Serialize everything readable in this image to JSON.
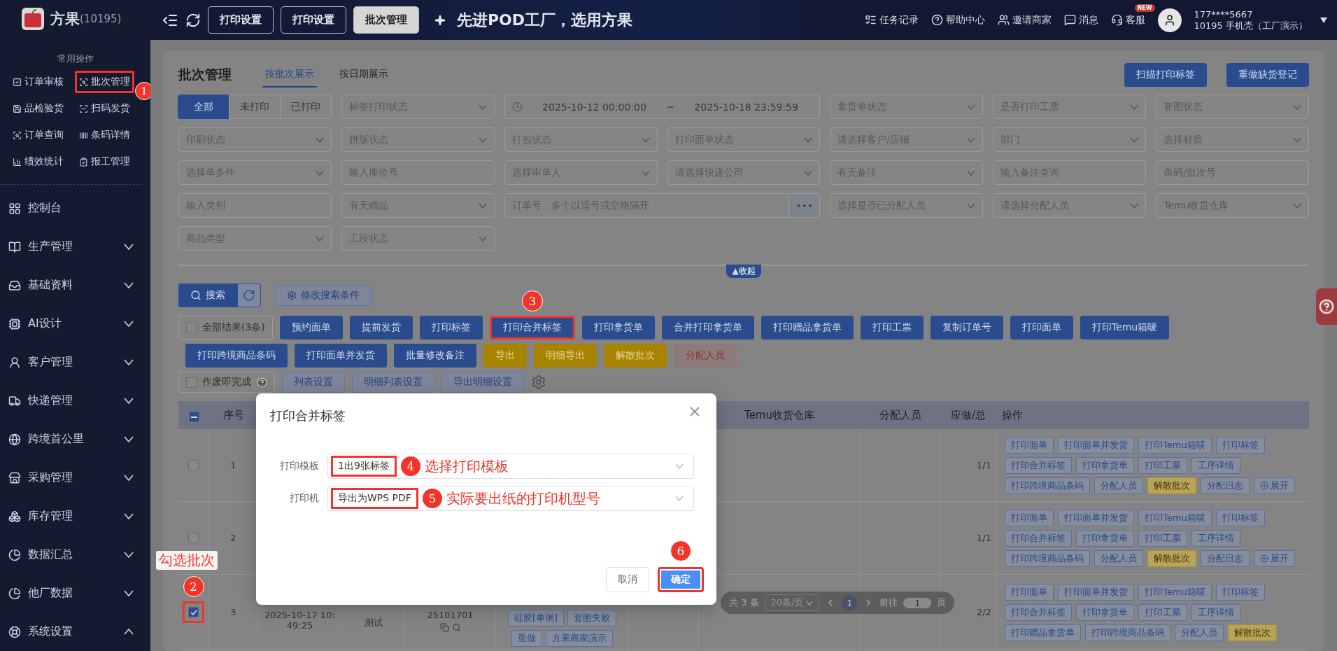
{
  "sidebar": {
    "brand": "方果",
    "brand_id": "(10195)",
    "quick_title": "常用操作",
    "quick_items": [
      {
        "label": "订单审核",
        "annotated": false
      },
      {
        "label": "批次管理",
        "annotated": true,
        "badge": "1"
      },
      {
        "label": "品检验货",
        "annotated": false
      },
      {
        "label": "扫码发货",
        "annotated": false
      },
      {
        "label": "订单查询",
        "annotated": false
      },
      {
        "label": "条码详情",
        "annotated": false
      },
      {
        "label": "绩效统计",
        "annotated": false
      },
      {
        "label": "报工管理",
        "annotated": false
      }
    ],
    "menu": [
      {
        "label": "控制台",
        "kind": "link"
      },
      {
        "label": "生产管理",
        "kind": "group",
        "expanded": false
      },
      {
        "label": "基础资料",
        "kind": "group",
        "expanded": false
      },
      {
        "label": "AI设计",
        "kind": "group",
        "expanded": false
      },
      {
        "label": "客户管理",
        "kind": "group",
        "expanded": false
      },
      {
        "label": "快递管理",
        "kind": "group",
        "expanded": false
      },
      {
        "label": "跨境首公里",
        "kind": "group",
        "expanded": false
      },
      {
        "label": "采购管理",
        "kind": "group",
        "expanded": false
      },
      {
        "label": "库存管理",
        "kind": "group",
        "expanded": false
      },
      {
        "label": "数据汇总",
        "kind": "group",
        "expanded": false
      },
      {
        "label": "他厂数据",
        "kind": "group",
        "expanded": false
      },
      {
        "label": "系统设置",
        "kind": "group",
        "expanded": true
      }
    ]
  },
  "header": {
    "tabs": [
      {
        "label": "打印设置",
        "selected": false
      },
      {
        "label": "打印设置",
        "selected": false
      },
      {
        "label": "批次管理",
        "selected": true
      }
    ],
    "slogan": "先进POD工厂，选用方果",
    "links": [
      {
        "label": "任务记录"
      },
      {
        "label": "帮助中心"
      },
      {
        "label": "邀请商家"
      },
      {
        "label": "消息"
      },
      {
        "label": "客服",
        "badge": "NEW"
      }
    ],
    "user": {
      "phone": "177****5667",
      "account": "10195  手机壳（工厂演示）"
    }
  },
  "page": {
    "title": "批次管理",
    "view_tabs": [
      {
        "label": "按批次展示",
        "selected": true
      },
      {
        "label": "按日期展示",
        "selected": false
      }
    ],
    "top_buttons": [
      "扫描打印标签",
      "重做缺货登记"
    ]
  },
  "filters": [
    [
      {
        "kind": "segment",
        "options": [
          {
            "label": "全部",
            "selected": true
          },
          {
            "label": "未打印",
            "selected": false
          },
          {
            "label": "已打印",
            "selected": false
          }
        ]
      },
      {
        "kind": "select",
        "placeholder": "标签打印状态"
      },
      {
        "kind": "date_range",
        "start": "2025-10-12 00:00:00",
        "separator": "~",
        "end": "2025-10-18 23:59:59"
      },
      {
        "kind": "select",
        "placeholder": "拿货单状态"
      },
      {
        "kind": "select",
        "placeholder": "是否打印工票"
      },
      {
        "kind": "select",
        "placeholder": "套图状态"
      }
    ],
    [
      {
        "kind": "select",
        "placeholder": "印刷状态"
      },
      {
        "kind": "select",
        "placeholder": "拼版状态"
      },
      {
        "kind": "select",
        "placeholder": "打包状态"
      },
      {
        "kind": "select",
        "placeholder": "打印面单状态"
      },
      {
        "kind": "select",
        "placeholder": "请选择客户/店铺"
      },
      {
        "kind": "select",
        "placeholder": "部门"
      },
      {
        "kind": "select",
        "placeholder": "选择材质"
      }
    ],
    [
      {
        "kind": "select",
        "placeholder": "选择单多件"
      },
      {
        "kind": "input",
        "placeholder": "输入库位号"
      },
      {
        "kind": "select",
        "placeholder": "选择审单人"
      },
      {
        "kind": "select",
        "placeholder": "请选择快递公司"
      },
      {
        "kind": "select",
        "placeholder": "有无备注"
      },
      {
        "kind": "input",
        "placeholder": "输入备注查询"
      },
      {
        "kind": "input",
        "placeholder": "条码/批次号"
      }
    ],
    [
      {
        "kind": "input",
        "placeholder": "输入类别"
      },
      {
        "kind": "select",
        "placeholder": "有无赠品"
      },
      {
        "kind": "order_input",
        "placeholder": "订单号，多个以逗号或空格隔开",
        "button": "•••"
      },
      {
        "kind": "select",
        "placeholder": "选择是否已分配人员"
      },
      {
        "kind": "select",
        "placeholder": "请选择分配人员"
      },
      {
        "kind": "select",
        "placeholder": "Temu收货仓库"
      }
    ],
    [
      {
        "kind": "select",
        "placeholder": "商品类型"
      },
      {
        "kind": "select",
        "placeholder": "工段状态"
      }
    ]
  ],
  "collapse": "▲收起",
  "search": {
    "button": "搜索",
    "modify": "修改搜索条件"
  },
  "action_rows": [
    [
      {
        "kind": "checkbox",
        "label": "全部结果(3条)",
        "checked": false
      },
      {
        "kind": "primary",
        "label": "预约面单",
        "annotated": false
      },
      {
        "kind": "primary",
        "label": "提前发货",
        "annotated": false
      },
      {
        "kind": "primary",
        "label": "打印标签",
        "annotated": false
      },
      {
        "kind": "primary",
        "label": "打印合并标签",
        "annotated": true,
        "badge": "3"
      },
      {
        "kind": "primary",
        "label": "打印拿货单",
        "annotated": false
      },
      {
        "kind": "primary",
        "label": "合并打印拿货单",
        "annotated": false
      },
      {
        "kind": "primary",
        "label": "打印赠品拿货单",
        "annotated": false
      },
      {
        "kind": "primary",
        "label": "打印工票",
        "annotated": false
      },
      {
        "kind": "primary",
        "label": "复制订单号",
        "annotated": false
      },
      {
        "kind": "primary",
        "label": "打印面单",
        "annotated": false
      },
      {
        "kind": "primary",
        "label": "打印Temu箱唛",
        "annotated": false
      }
    ],
    [
      {
        "kind": "primary",
        "label": "打印跨境商品条码",
        "annotated": false
      },
      {
        "kind": "primary",
        "label": "打印面单并发货",
        "annotated": false
      },
      {
        "kind": "primary",
        "label": "批量修改备注",
        "annotated": false
      },
      {
        "kind": "warning",
        "label": "导出",
        "annotated": false
      },
      {
        "kind": "warning",
        "label": "明细导出",
        "annotated": false
      },
      {
        "kind": "warning",
        "label": "解散批次",
        "annotated": false
      },
      {
        "kind": "danger",
        "label": "分配人员",
        "annotated": false
      }
    ]
  ],
  "tools": {
    "checkbox": {
      "label": "作废即完成",
      "checked": false
    },
    "buttons": [
      "列表设置",
      "明细列表设置",
      "导出明细设置"
    ]
  },
  "table": {
    "select_all": {
      "indeterminate": true
    },
    "columns": [
      "序号",
      "Temu收货仓库",
      "分配人员",
      "应做/总",
      "操作"
    ],
    "rows": [
      {
        "selected": false,
        "annotated": false,
        "seq": "1",
        "count": "1/1",
        "ops": [
          {
            "label": "打印面单",
            "kind": "normal"
          },
          {
            "label": "打印面单并发货",
            "kind": "normal"
          },
          {
            "label": "打印Temu箱唛",
            "kind": "normal"
          },
          {
            "label": "打印标签",
            "kind": "normal"
          },
          {
            "label": "打印合并标签",
            "kind": "normal"
          },
          {
            "label": "打印拿货单",
            "kind": "normal"
          },
          {
            "label": "打印工票",
            "kind": "normal"
          },
          {
            "label": "工序详情",
            "kind": "normal"
          },
          {
            "label": "打印跨境商品条码",
            "kind": "normal"
          },
          {
            "label": "分配人员",
            "kind": "normal"
          },
          {
            "label": "解散批次",
            "kind": "warning"
          },
          {
            "label": "分配日志",
            "kind": "normal"
          },
          {
            "label": "展开",
            "kind": "expand"
          }
        ]
      },
      {
        "selected": false,
        "annotated": false,
        "seq": "2",
        "count": "1/1",
        "ops": [
          {
            "label": "打印面单",
            "kind": "normal"
          },
          {
            "label": "打印面单并发货",
            "kind": "normal"
          },
          {
            "label": "打印Temu箱唛",
            "kind": "normal"
          },
          {
            "label": "打印标签",
            "kind": "normal"
          },
          {
            "label": "打印合并标签",
            "kind": "normal"
          },
          {
            "label": "打印拿货单",
            "kind": "normal"
          },
          {
            "label": "打印工票",
            "kind": "normal"
          },
          {
            "label": "工序详情",
            "kind": "normal"
          },
          {
            "label": "打印跨境商品条码",
            "kind": "normal"
          },
          {
            "label": "分配人员",
            "kind": "normal"
          },
          {
            "label": "解散批次",
            "kind": "warning"
          },
          {
            "label": "分配日志",
            "kind": "normal"
          },
          {
            "label": "展开",
            "kind": "expand"
          }
        ]
      },
      {
        "selected": true,
        "annotated": true,
        "badge": "2",
        "note": "勾选批次",
        "seq": "3",
        "time": "2025-10-17 10:49:25",
        "name": "测试",
        "batch": "25101701",
        "tags": [
          "硅胶[单侧]",
          "套图失败",
          "重做",
          "方果商家演示"
        ],
        "count": "2/2",
        "ops": [
          {
            "label": "打印面单",
            "kind": "normal"
          },
          {
            "label": "打印面单并发货",
            "kind": "normal"
          },
          {
            "label": "打印Temu箱唛",
            "kind": "normal"
          },
          {
            "label": "打印标签",
            "kind": "normal"
          },
          {
            "label": "打印合并标签",
            "kind": "normal"
          },
          {
            "label": "打印拿货单",
            "kind": "normal"
          },
          {
            "label": "打印工票",
            "kind": "normal"
          },
          {
            "label": "工序详情",
            "kind": "normal"
          },
          {
            "label": "打印赠品拿货单",
            "kind": "normal"
          },
          {
            "label": "打印跨境商品条码",
            "kind": "normal"
          },
          {
            "label": "分配人员",
            "kind": "normal"
          },
          {
            "label": "解散批次",
            "kind": "warning"
          }
        ]
      }
    ]
  },
  "pagination": {
    "total": "共 3 条",
    "page_size": "20条/页",
    "pages": [
      {
        "label": "1",
        "selected": true
      }
    ],
    "goto": "前往",
    "goto_value": "1",
    "page_unit": "页"
  },
  "dialog": {
    "title": "打印合并标签",
    "fields": [
      {
        "label": "打印模板",
        "value": "1出9张标签",
        "annotated": true,
        "badge": "4",
        "note": "选择打印模板"
      },
      {
        "label": "打印机",
        "value": "导出为WPS PDF",
        "annotated": true,
        "badge": "5",
        "note": "实际要出纸的打印机型号"
      }
    ],
    "buttons": [
      {
        "label": "取消",
        "kind": "default",
        "annotated": false
      },
      {
        "label": "确定",
        "kind": "primary",
        "annotated": true,
        "badge": "6"
      }
    ]
  }
}
